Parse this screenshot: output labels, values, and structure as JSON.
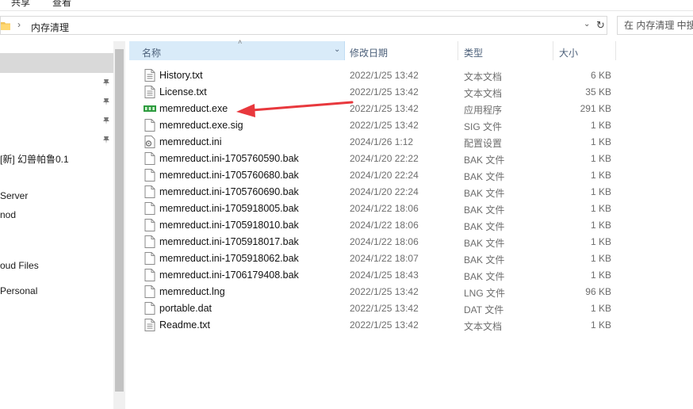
{
  "ribbon": {
    "share": "共享",
    "view": "查看"
  },
  "address": {
    "path_segment": "内存清理",
    "separator": "›",
    "refresh_icon": "refresh-icon",
    "dropdown_icon": "chevron-down-icon"
  },
  "search": {
    "placeholder": "在 内存清理 中搜"
  },
  "nav": {
    "items": [
      {
        "label": "[新] 幻兽帕鲁0.1"
      },
      {
        "label": "Server"
      },
      {
        "label": "nod"
      },
      {
        "label": "oud Files"
      },
      {
        "label": " Personal"
      }
    ]
  },
  "columns": {
    "name": "名称",
    "date": "修改日期",
    "type": "类型",
    "size": "大小"
  },
  "files": [
    {
      "name": "History.txt",
      "date": "2022/1/25 13:42",
      "type": "文本文档",
      "size": "6 KB",
      "icon": "text-file-icon"
    },
    {
      "name": "License.txt",
      "date": "2022/1/25 13:42",
      "type": "文本文档",
      "size": "35 KB",
      "icon": "text-file-icon"
    },
    {
      "name": "memreduct.exe",
      "date": "2022/1/25 13:42",
      "type": "应用程序",
      "size": "291 KB",
      "icon": "memory-app-icon"
    },
    {
      "name": "memreduct.exe.sig",
      "date": "2022/1/25 13:42",
      "type": "SIG 文件",
      "size": "1 KB",
      "icon": "file-icon"
    },
    {
      "name": "memreduct.ini",
      "date": "2024/1/26 1:12",
      "type": "配置设置",
      "size": "1 KB",
      "icon": "config-file-icon"
    },
    {
      "name": "memreduct.ini-1705760590.bak",
      "date": "2024/1/20 22:22",
      "type": "BAK 文件",
      "size": "1 KB",
      "icon": "file-icon"
    },
    {
      "name": "memreduct.ini-1705760680.bak",
      "date": "2024/1/20 22:24",
      "type": "BAK 文件",
      "size": "1 KB",
      "icon": "file-icon"
    },
    {
      "name": "memreduct.ini-1705760690.bak",
      "date": "2024/1/20 22:24",
      "type": "BAK 文件",
      "size": "1 KB",
      "icon": "file-icon"
    },
    {
      "name": "memreduct.ini-1705918005.bak",
      "date": "2024/1/22 18:06",
      "type": "BAK 文件",
      "size": "1 KB",
      "icon": "file-icon"
    },
    {
      "name": "memreduct.ini-1705918010.bak",
      "date": "2024/1/22 18:06",
      "type": "BAK 文件",
      "size": "1 KB",
      "icon": "file-icon"
    },
    {
      "name": "memreduct.ini-1705918017.bak",
      "date": "2024/1/22 18:06",
      "type": "BAK 文件",
      "size": "1 KB",
      "icon": "file-icon"
    },
    {
      "name": "memreduct.ini-1705918062.bak",
      "date": "2024/1/22 18:07",
      "type": "BAK 文件",
      "size": "1 KB",
      "icon": "file-icon"
    },
    {
      "name": "memreduct.ini-1706179408.bak",
      "date": "2024/1/25 18:43",
      "type": "BAK 文件",
      "size": "1 KB",
      "icon": "file-icon"
    },
    {
      "name": "memreduct.lng",
      "date": "2022/1/25 13:42",
      "type": "LNG 文件",
      "size": "96 KB",
      "icon": "file-icon"
    },
    {
      "name": "portable.dat",
      "date": "2022/1/25 13:42",
      "type": "DAT 文件",
      "size": "1 KB",
      "icon": "file-icon"
    },
    {
      "name": "Readme.txt",
      "date": "2022/1/25 13:42",
      "type": "文本文档",
      "size": "1 KB",
      "icon": "text-file-icon"
    }
  ],
  "annotation": {
    "arrow_color": "#e8383d",
    "points_to": "memreduct.exe"
  },
  "colors": {
    "header_selected": "#d9ebf9",
    "nav_selected": "#d9d9d9",
    "app_icon": "#2e9c3f"
  }
}
